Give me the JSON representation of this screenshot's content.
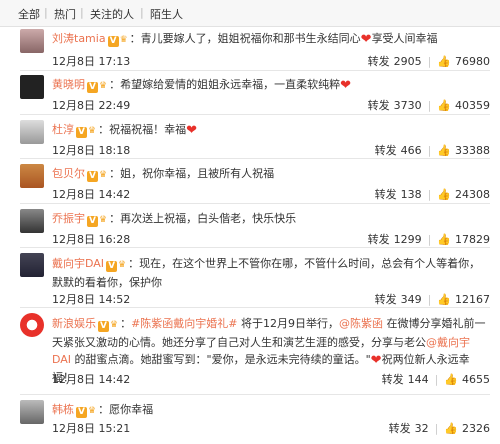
{
  "tabs": [
    "全部",
    "热门",
    "关注的人",
    "陌生人"
  ],
  "comments": [
    {
      "user": "刘涛tamia",
      "text": "：青儿要嫁人了，姐姐祝福你和那书生永结同心",
      "text2": "享受人间幸福",
      "date": "12月8日 17:13",
      "repost_label": "转发",
      "reposts": "2905",
      "likes": "76980"
    },
    {
      "user": "黄晓明",
      "text": "：希望嫁给爱情的姐姐永远幸福，一直柔软纯粹",
      "text2": "",
      "date": "12月8日 22:49",
      "repost_label": "转发",
      "reposts": "3730",
      "likes": "40359"
    },
    {
      "user": "杜淳",
      "text": "：祝福祝福！幸福",
      "text2": "",
      "date": "12月8日 18:18",
      "repost_label": "转发",
      "reposts": "466",
      "likes": "33388"
    },
    {
      "user": "包贝尔",
      "text": "：姐，祝你幸福，且被所有人祝福",
      "text2": "",
      "date": "12月8日 14:42",
      "repost_label": "转发",
      "reposts": "138",
      "likes": "24308"
    },
    {
      "user": "乔振宇",
      "text": "：再次送上祝福，白头偕老，快乐快乐",
      "text2": "",
      "date": "12月8日 16:28",
      "repost_label": "转发",
      "reposts": "1299",
      "likes": "17829"
    },
    {
      "user": "戴向宇DAI",
      "text": "：现在，在这个世界上不管你在哪，不管什么时间，总会有个人等着你，默默的看着你，保护你",
      "text2": "",
      "date": "12月8日 14:52",
      "repost_label": "转发",
      "reposts": "349",
      "likes": "12167"
    },
    {
      "user": "新浪娱乐",
      "text": "：",
      "tag1": "#陈紫函戴向宇婚礼#",
      "text_mid": " 将于12月9日举行，",
      "mention": "@陈紫函",
      "text_rest": " 在微博分享婚礼前一天紧张又激动的心情。她还分享了自己对人生和演艺生涯的感受，分享与老公",
      "mention2": "@戴向宇DAI",
      "text_end": " 的甜蜜点滴。她甜蜜写到：\"爱你，是永远未完待续的童话。\"",
      "text2": "祝两位新人永远幸福！",
      "date": "12月8日 14:42",
      "repost_label": "转发",
      "reposts": "144",
      "likes": "4655"
    },
    {
      "user": "韩栋",
      "text": "：愿你幸福",
      "text2": "",
      "date": "12月8日 15:21",
      "repost_label": "转发",
      "reposts": "32",
      "likes": "2326"
    }
  ],
  "icons": {
    "heart": "heart-icon",
    "thumb": "thumb-up-icon",
    "verified": "verified-badge-icon"
  },
  "colors": {
    "username": "#eb7350",
    "heart": "#e8312a",
    "badge": "#f5a623"
  }
}
